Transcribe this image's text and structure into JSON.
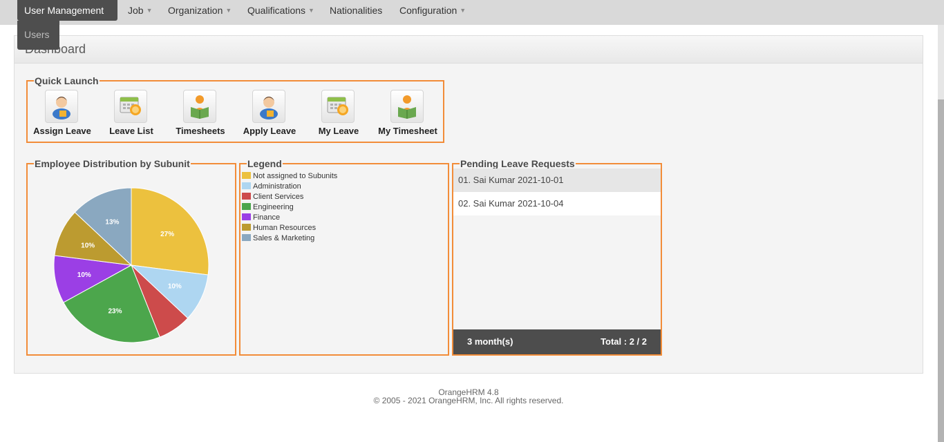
{
  "nav": {
    "items": [
      {
        "label": "User Management",
        "dropdown": false
      },
      {
        "label": "Job",
        "dropdown": true
      },
      {
        "label": "Organization",
        "dropdown": true
      },
      {
        "label": "Qualifications",
        "dropdown": true
      },
      {
        "label": "Nationalities",
        "dropdown": false
      },
      {
        "label": "Configuration",
        "dropdown": true
      }
    ],
    "submenu_item": "Users"
  },
  "dashboard": {
    "title": "Dashboard"
  },
  "quick_launch": {
    "title": "Quick Launch",
    "items": [
      {
        "label": "Assign Leave",
        "icon": "assign-leave-icon"
      },
      {
        "label": "Leave List",
        "icon": "leave-list-icon"
      },
      {
        "label": "Timesheets",
        "icon": "timesheets-icon"
      },
      {
        "label": "Apply Leave",
        "icon": "apply-leave-icon"
      },
      {
        "label": "My Leave",
        "icon": "my-leave-icon"
      },
      {
        "label": "My Timesheet",
        "icon": "my-timesheet-icon"
      }
    ]
  },
  "chart_data": {
    "type": "pie",
    "title": "Employee Distribution by Subunit",
    "slices": [
      {
        "label": "Not assigned to Subunits",
        "value": 27,
        "color": "#ecc13e"
      },
      {
        "label": "Administration",
        "value": 10,
        "color": "#aed6f1"
      },
      {
        "label": "Client Services",
        "value": 7,
        "color": "#cd4b4b"
      },
      {
        "label": "Engineering",
        "value": 23,
        "color": "#4ca64c"
      },
      {
        "label": "Finance",
        "value": 10,
        "color": "#9b3fe5"
      },
      {
        "label": "Human Resources",
        "value": 10,
        "color": "#bc9b30"
      },
      {
        "label": "Sales & Marketing",
        "value": 13,
        "color": "#8aa8c0"
      }
    ],
    "shown_labels": [
      "27%",
      "10%",
      "",
      "23%",
      "10%",
      "10%",
      "13%"
    ]
  },
  "legend": {
    "title": "Legend"
  },
  "pending": {
    "title": "Pending Leave Requests",
    "rows": [
      "01. Sai Kumar 2021-10-01",
      "02. Sai Kumar 2021-10-04"
    ],
    "period": "3 month(s)",
    "total": "Total : 2 / 2"
  },
  "footer": {
    "version": "OrangeHRM 4.8",
    "copyright": "© 2005 - 2021 OrangeHRM, Inc. All rights reserved."
  },
  "colors": {
    "accent": "#f28c38",
    "nav_active": "#4e4e4e"
  }
}
